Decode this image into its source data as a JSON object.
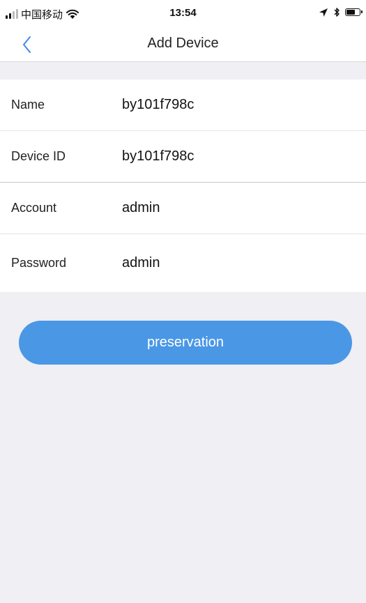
{
  "status_bar": {
    "carrier": "中国移动",
    "time": "13:54",
    "signal_bars": 4,
    "signal_active": 2,
    "battery_level": 0.75
  },
  "nav": {
    "title": "Add Device",
    "back_icon": "chevron-left-icon",
    "accent_color": "#3b8beb"
  },
  "form": {
    "rows": [
      {
        "label": "Name",
        "value": "by101f798c"
      },
      {
        "label": "Device ID",
        "value": "by101f798c"
      },
      {
        "label": "Account",
        "value": "admin"
      },
      {
        "label": "Password",
        "value": "admin"
      }
    ]
  },
  "actions": {
    "save_label": "preservation",
    "save_color": "#4a97e6"
  }
}
